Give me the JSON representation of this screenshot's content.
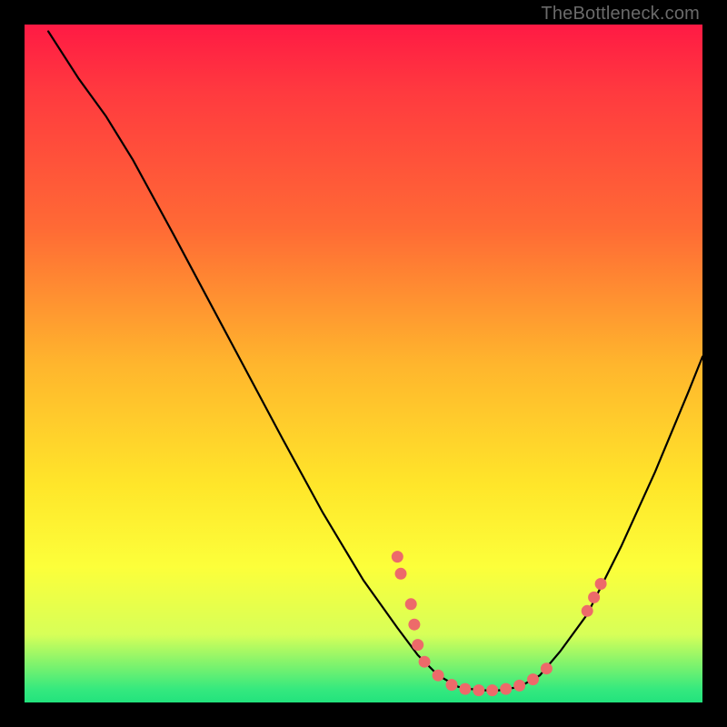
{
  "watermark": "TheBottleneck.com",
  "chart_data": {
    "type": "line",
    "title": "",
    "xlabel": "",
    "ylabel": "",
    "xlim": [
      0,
      100
    ],
    "ylim": [
      0,
      100
    ],
    "curve": [
      {
        "x": 3.5,
        "y": 99.0
      },
      {
        "x": 8.0,
        "y": 92.0
      },
      {
        "x": 12.0,
        "y": 86.5
      },
      {
        "x": 16.0,
        "y": 80.0
      },
      {
        "x": 22.0,
        "y": 69.0
      },
      {
        "x": 30.0,
        "y": 54.0
      },
      {
        "x": 38.0,
        "y": 39.0
      },
      {
        "x": 44.0,
        "y": 28.0
      },
      {
        "x": 50.0,
        "y": 18.0
      },
      {
        "x": 55.0,
        "y": 11.0
      },
      {
        "x": 58.0,
        "y": 7.0
      },
      {
        "x": 61.0,
        "y": 4.0
      },
      {
        "x": 64.0,
        "y": 2.3
      },
      {
        "x": 67.0,
        "y": 1.8
      },
      {
        "x": 70.0,
        "y": 1.8
      },
      {
        "x": 73.0,
        "y": 2.3
      },
      {
        "x": 76.0,
        "y": 4.0
      },
      {
        "x": 79.0,
        "y": 7.5
      },
      {
        "x": 83.0,
        "y": 13.0
      },
      {
        "x": 88.0,
        "y": 23.0
      },
      {
        "x": 93.0,
        "y": 34.0
      },
      {
        "x": 98.0,
        "y": 46.0
      },
      {
        "x": 100.0,
        "y": 51.0
      }
    ],
    "points": [
      {
        "x": 55.0,
        "y": 21.5
      },
      {
        "x": 55.5,
        "y": 19.0
      },
      {
        "x": 57.0,
        "y": 14.5
      },
      {
        "x": 57.5,
        "y": 11.5
      },
      {
        "x": 58.0,
        "y": 8.5
      },
      {
        "x": 59.0,
        "y": 6.0
      },
      {
        "x": 61.0,
        "y": 4.0
      },
      {
        "x": 63.0,
        "y": 2.6
      },
      {
        "x": 65.0,
        "y": 2.0
      },
      {
        "x": 67.0,
        "y": 1.8
      },
      {
        "x": 69.0,
        "y": 1.8
      },
      {
        "x": 71.0,
        "y": 2.0
      },
      {
        "x": 73.0,
        "y": 2.5
      },
      {
        "x": 75.0,
        "y": 3.4
      },
      {
        "x": 77.0,
        "y": 5.0
      },
      {
        "x": 83.0,
        "y": 13.5
      },
      {
        "x": 84.0,
        "y": 15.5
      },
      {
        "x": 85.0,
        "y": 17.5
      }
    ],
    "point_radius": 6.5
  }
}
